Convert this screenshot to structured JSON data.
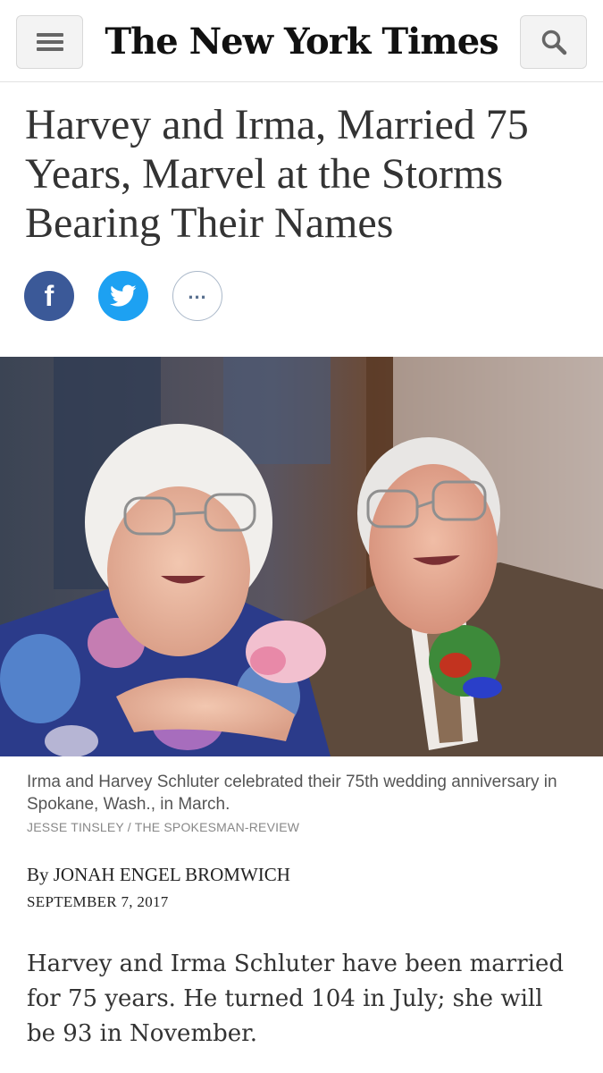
{
  "header": {
    "masthead": "The New York Times",
    "menu_icon": "hamburger-menu-icon",
    "search_icon": "search-icon"
  },
  "article": {
    "headline": "Harvey and Irma, Married 75 Years, Marvel at the Storms Bearing Their Names",
    "share": {
      "facebook_icon": "facebook-icon",
      "facebook_glyph": "f",
      "twitter_icon": "twitter-icon",
      "more_icon": "more-options-icon",
      "more_glyph": "..."
    },
    "photo": {
      "caption": "Irma and Harvey Schluter celebrated their 75th wedding anniversary in Spokane, Wash., in March.",
      "credit": "JESSE TINSLEY / THE SPOKESMAN-REVIEW"
    },
    "byline": "By JONAH ENGEL BROMWICH",
    "date": "SEPTEMBER 7, 2017",
    "body_first_paragraph": "Harvey and Irma Schluter have been married for 75 years. He turned 104 in July; she will be 93 in November."
  },
  "colors": {
    "facebook": "#3b5998",
    "twitter": "#1da1f2",
    "headline_text": "#333333",
    "caption_text": "#555555"
  }
}
